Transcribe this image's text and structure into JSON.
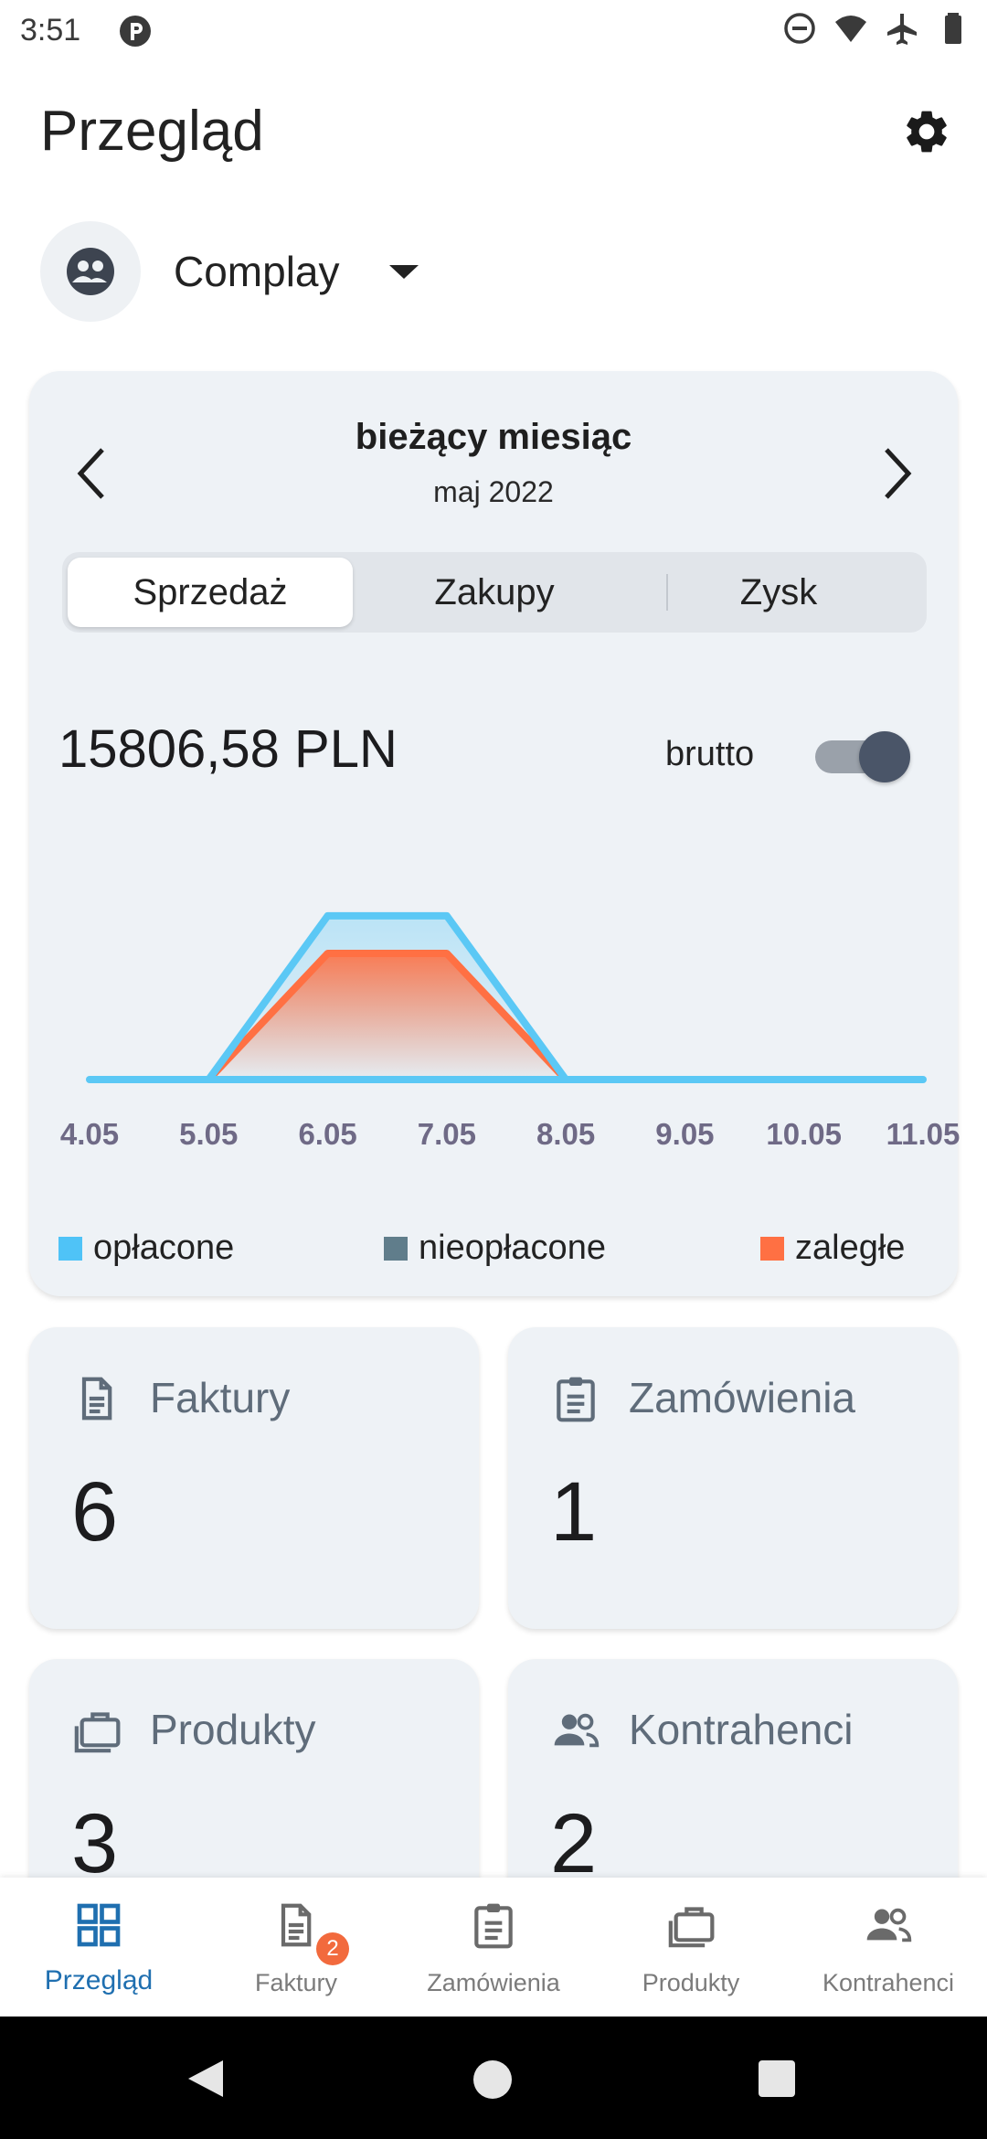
{
  "status_bar": {
    "time": "3:51",
    "icons": [
      "app-icon",
      "do-not-disturb-icon",
      "wifi-icon",
      "airplane-icon",
      "battery-icon"
    ]
  },
  "header": {
    "title": "Przegląd",
    "settings_icon": "gear-icon"
  },
  "company": {
    "name": "Complay",
    "avatar_icon": "people-circle-icon",
    "dropdown_icon": "caret-down-icon"
  },
  "summary_card": {
    "period_title": "bieżący miesiąc",
    "period_month": "maj 2022",
    "tabs": [
      {
        "label": "Sprzedaż",
        "active": true
      },
      {
        "label": "Zakupy",
        "active": false
      },
      {
        "label": "Zysk",
        "active": false
      }
    ],
    "amount": "15806,58 PLN",
    "gross_toggle_label": "brutto",
    "gross_toggle_on": true,
    "legend": [
      {
        "label": "opłacone",
        "color": "#4fc3f7"
      },
      {
        "label": "nieopłacone",
        "color": "#607d8b"
      },
      {
        "label": "zaległe",
        "color": "#ff7043"
      }
    ]
  },
  "chart_data": {
    "type": "area",
    "categories": [
      "4.05",
      "5.05",
      "6.05",
      "7.05",
      "8.05",
      "9.05",
      "10.05",
      "11.05"
    ],
    "series": [
      {
        "name": "opłacone",
        "color": "#5bc8f5",
        "values": [
          0,
          0,
          1.0,
          1.0,
          0,
          0,
          0,
          0
        ]
      },
      {
        "name": "zaległe",
        "color": "#ff7043",
        "values": [
          0,
          0,
          0.77,
          0.77,
          0,
          0,
          0,
          0
        ]
      }
    ],
    "ylim": [
      0,
      1.2
    ],
    "grid": false,
    "legend_position": "bottom"
  },
  "tiles": [
    {
      "label": "Faktury",
      "value": "6",
      "icon": "document-icon"
    },
    {
      "label": "Zamówienia",
      "value": "1",
      "icon": "clipboard-icon"
    },
    {
      "label": "Produkty",
      "value": "3",
      "icon": "briefcase-icon"
    },
    {
      "label": "Kontrahenci",
      "value": "2",
      "icon": "people-icon"
    }
  ],
  "bottom_nav": [
    {
      "label": "Przegląd",
      "icon": "dashboard-grid-icon",
      "active": true
    },
    {
      "label": "Faktury",
      "icon": "document-icon",
      "active": false,
      "badge": "2"
    },
    {
      "label": "Zamówienia",
      "icon": "clipboard-icon",
      "active": false
    },
    {
      "label": "Produkty",
      "icon": "briefcase-icon",
      "active": false
    },
    {
      "label": "Kontrahenci",
      "icon": "people-icon",
      "active": false
    }
  ]
}
